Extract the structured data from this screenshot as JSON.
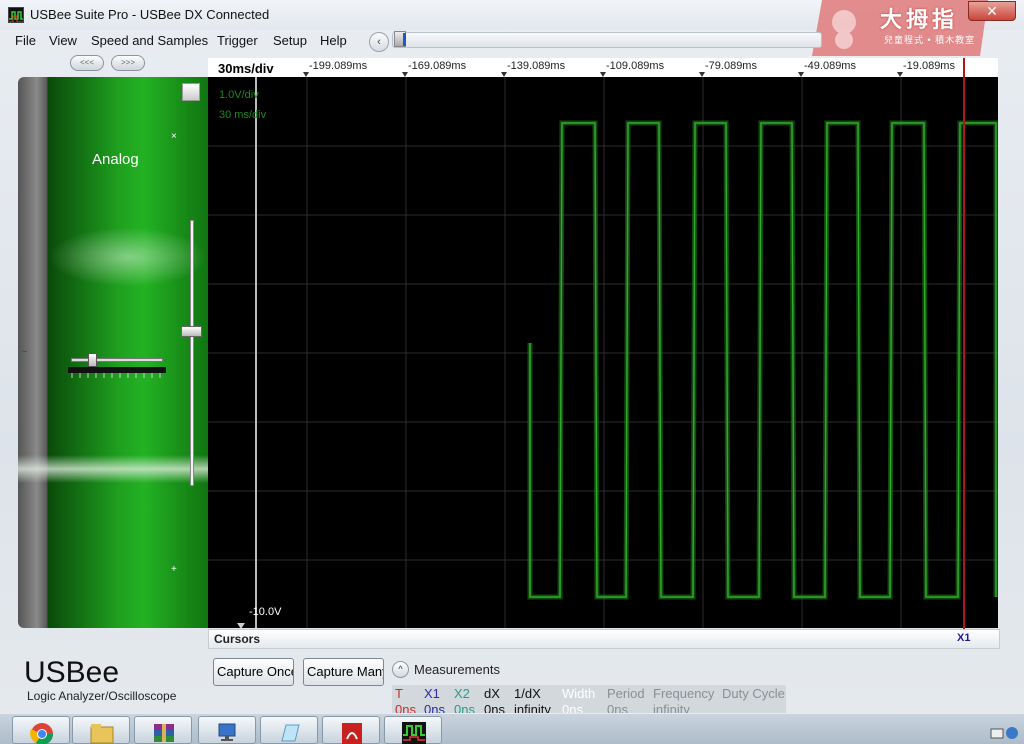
{
  "window": {
    "title": "USBee Suite Pro - USBee DX Connected",
    "close_glyph": "✕",
    "badge_text": "大拇指",
    "badge_subtext": "兒童程式 • 積木教室"
  },
  "menu": {
    "items": [
      "File",
      "View",
      "Speed and Samples",
      "Trigger",
      "Setup",
      "Help"
    ]
  },
  "nav": {
    "prev_label": "<<<",
    "next_label": ">>>",
    "scroll_glyph": "‹"
  },
  "channel": {
    "label": "Analog",
    "close_glyph": "×",
    "add_glyph": "+",
    "coupling_glyph": "~"
  },
  "scope": {
    "time_per_div": "30ms/div",
    "time_labels": [
      "-199.089ms",
      "-169.089ms",
      "-139.089ms",
      "-109.089ms",
      "-79.089ms",
      "-49.089ms",
      "-19.089ms"
    ],
    "volts_per_div": "1.0V/div",
    "ms_per_div": "30 ms/div",
    "offset_voltage": "-10.0V",
    "trace_color": "#2faa2a",
    "cursor_color": "#b0151b"
  },
  "cursors": {
    "label": "Cursors",
    "x_marker": "X1"
  },
  "brand": {
    "name": "USBee",
    "subtitle": "Logic Analyzer/Oscilloscope"
  },
  "buttons": {
    "capture_once": "Capture Once",
    "capture_many": "Capture Many"
  },
  "measurements": {
    "title": "Measurements",
    "toggle_glyph": "^",
    "columns": [
      {
        "head": "T",
        "value": "0ns",
        "color": "#c23030"
      },
      {
        "head": "X1",
        "value": "0ns",
        "color": "#2a2aa8"
      },
      {
        "head": "X2",
        "value": "0ns",
        "color": "#2a9a8a"
      },
      {
        "head": "dX",
        "value": "0ns",
        "color": "#111111"
      },
      {
        "head": "1/dX",
        "value": "infinity",
        "color": "#111111"
      },
      {
        "head": "Width",
        "value": "0ns",
        "color": "#ffffff"
      },
      {
        "head": "Period",
        "value": "0ns",
        "color": "#8a8f94"
      },
      {
        "head": "Frequency",
        "value": "infinity",
        "color": "#8a8f94"
      },
      {
        "head": "Duty Cycle",
        "value": "",
        "color": "#8a8f94"
      }
    ]
  },
  "taskbar": {
    "apps": [
      "chrome-icon",
      "explorer-icon",
      "winrar-icon",
      "network-icon",
      "notes-icon",
      "pdf-icon",
      "usbee-icon"
    ]
  }
}
